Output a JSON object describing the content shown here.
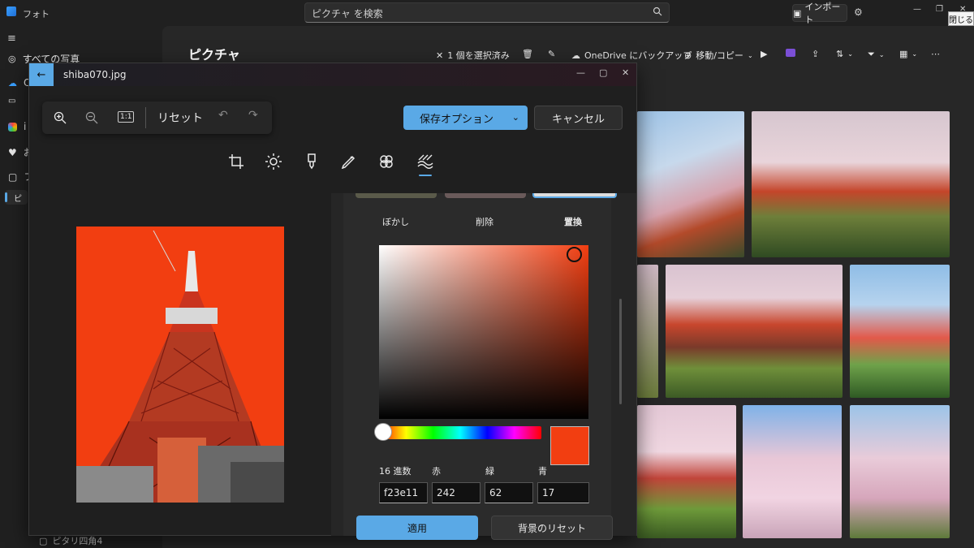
{
  "app": {
    "title": "フォト",
    "search_placeholder": "ピクチャ を検索",
    "import_label": "インポート",
    "close_tooltip": "閉じる"
  },
  "nav": {
    "items": [
      {
        "label": "すべての写真"
      },
      {
        "label": "O"
      },
      {
        "label": ""
      },
      {
        "label": "i"
      },
      {
        "label": "お"
      },
      {
        "label": "フ"
      },
      {
        "label": "ピ"
      }
    ],
    "bottom_folder": "ピタリ四角4"
  },
  "main": {
    "title": "ピクチャ",
    "toolbar": {
      "selected": "1 個を選択済み",
      "backup": "OneDrive にバックアップ",
      "move_copy": "移動/コピー"
    }
  },
  "editor": {
    "file_name": "shiba070.jpg",
    "reset_label": "リセット",
    "save_label": "保存オプション",
    "cancel_label": "キャンセル",
    "options": {
      "blur": "ぼかし",
      "remove": "削除",
      "replace": "置換"
    },
    "color": {
      "hex_label": "16 進数",
      "red_label": "赤",
      "green_label": "緑",
      "blue_label": "青",
      "hex_value": "f23e11",
      "red_value": "242",
      "green_value": "62",
      "blue_value": "17",
      "swatch": "#f23e11"
    },
    "apply_label": "適用",
    "reset_bg_label": "背景のリセット"
  },
  "colors": {
    "accent": "#5aa9e6",
    "replacement": "#f23e11"
  }
}
